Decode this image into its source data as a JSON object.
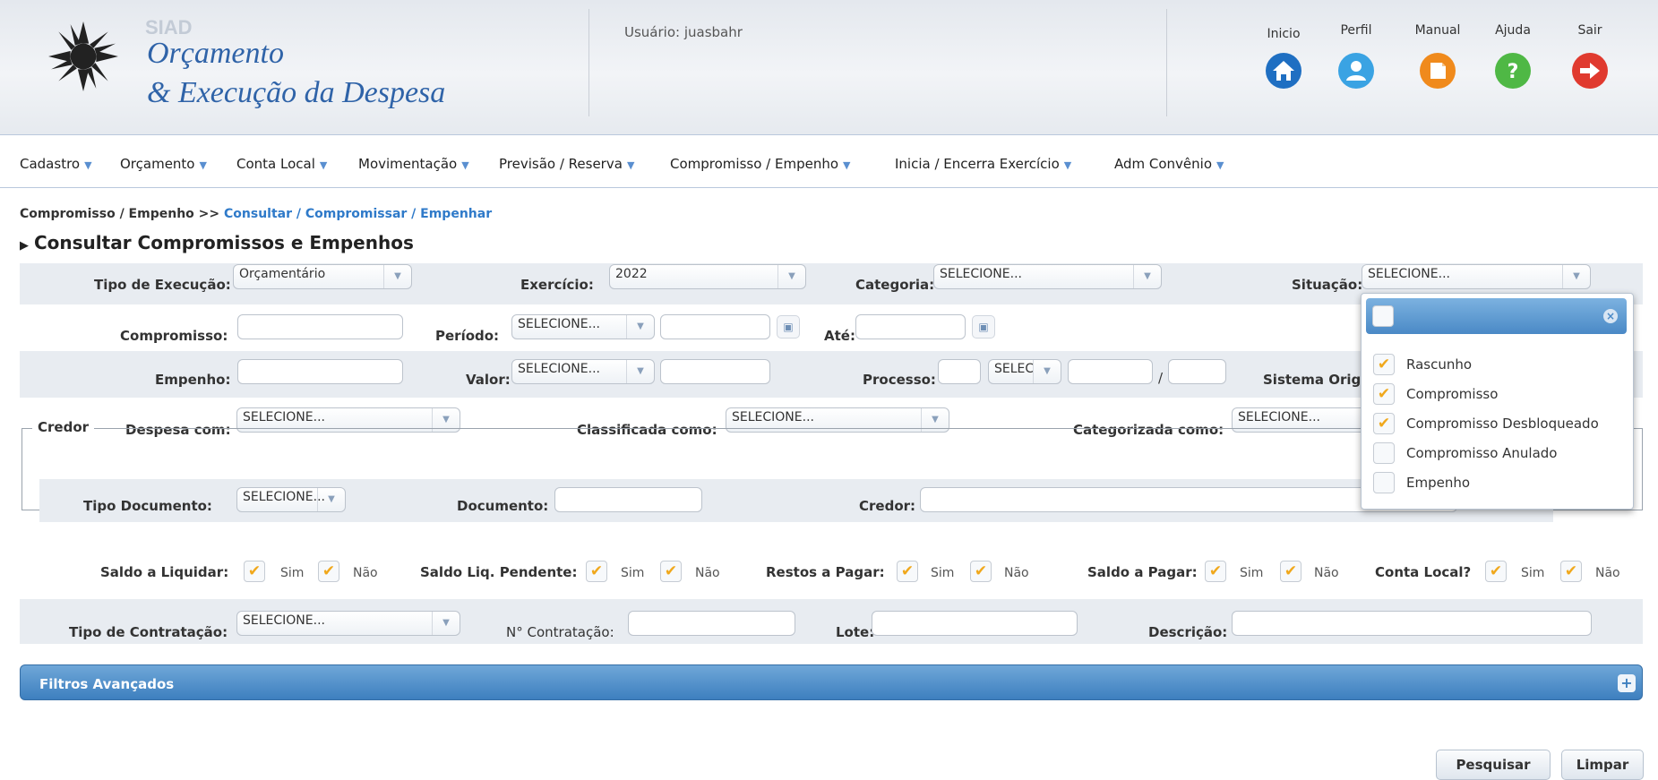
{
  "header": {
    "system_code": "SIAD",
    "title_line1": "Orçamento",
    "title_line2": "& Execução da Despesa",
    "user_label": "Usuário: juasbahr",
    "nav": [
      {
        "label": "Inicio",
        "icon": "home-icon",
        "color": "#1f6fc2"
      },
      {
        "label": "Perfil",
        "icon": "user-icon",
        "color": "#3aa3e3"
      },
      {
        "label": "Manual",
        "icon": "manual-icon",
        "color": "#f08a1c"
      },
      {
        "label": "Ajuda",
        "icon": "help-icon",
        "color": "#4fb845"
      },
      {
        "label": "Sair",
        "icon": "exit-icon",
        "color": "#e03a2f"
      }
    ]
  },
  "menu": [
    "Cadastro",
    "Orçamento",
    "Conta Local",
    "Movimentação",
    "Previsão / Reserva",
    "Compromisso / Empenho",
    "Inicia / Encerra Exercício",
    "Adm Convênio"
  ],
  "breadcrumb": {
    "root": "Compromisso / Empenho >>",
    "current": "Consultar / Compromissar / Empenhar"
  },
  "page_title": "Consultar Compromissos e Empenhos",
  "form": {
    "tipo_execucao": {
      "label": "Tipo de Execução:",
      "value": "Orçamentário"
    },
    "exercicio": {
      "label": "Exercício:",
      "value": "2022"
    },
    "categoria": {
      "label": "Categoria:",
      "value": "SELECIONE..."
    },
    "situacao": {
      "label": "Situação:",
      "value": "SELECIONE..."
    },
    "compromisso": {
      "label": "Compromisso:"
    },
    "periodo": {
      "label": "Período:",
      "value": "SELECIONE..."
    },
    "ate": {
      "label": "Até:"
    },
    "empenho": {
      "label": "Empenho:"
    },
    "valor": {
      "label": "Valor:",
      "value": "SELECIONE..."
    },
    "processo": {
      "label": "Processo:",
      "value": "SELEC",
      "sep": "/"
    },
    "sistema_origem": {
      "label": "Sistema Orig"
    },
    "despesa_com": {
      "label": "Despesa com:",
      "value": "SELECIONE..."
    },
    "classificada_como": {
      "label": "Classificada como:",
      "value": "SELECIONE..."
    },
    "categorizada_como": {
      "label": "Categorizada como:",
      "value": "SELECIONE..."
    },
    "credor_legend": "Credor",
    "tipo_documento": {
      "label": "Tipo Documento:",
      "value": "SELECIONE..."
    },
    "documento": {
      "label": "Documento:"
    },
    "credor": {
      "label": "Credor:"
    },
    "saldo_liquidar": {
      "label": "Saldo a Liquidar:",
      "yes": "Sim",
      "no": "Não"
    },
    "saldo_liq_pendente": {
      "label": "Saldo Liq. Pendente:",
      "yes": "Sim",
      "no": "Não"
    },
    "restos_pagar": {
      "label": "Restos a Pagar:",
      "yes": "Sim",
      "no": "Não"
    },
    "saldo_pagar": {
      "label": "Saldo a Pagar:",
      "yes": "Sim",
      "no": "Não"
    },
    "conta_local": {
      "label": "Conta Local?",
      "yes": "Sim",
      "no": "Não"
    },
    "tipo_contratacao": {
      "label": "Tipo de Contratação:",
      "value": "SELECIONE..."
    },
    "n_contratacao": {
      "label": "N° Contratação:"
    },
    "lote": {
      "label": "Lote:"
    },
    "descricao": {
      "label": "Descrição:"
    }
  },
  "advanced_filters": {
    "title": "Filtros Avançados"
  },
  "buttons": {
    "search": "Pesquisar",
    "clear": "Limpar"
  },
  "situacao_dropdown": {
    "items": [
      {
        "label": "Rascunho",
        "checked": true
      },
      {
        "label": "Compromisso",
        "checked": true
      },
      {
        "label": "Compromisso Desbloqueado",
        "checked": true
      },
      {
        "label": "Compromisso Anulado",
        "checked": false
      },
      {
        "label": "Empenho",
        "checked": false
      }
    ]
  },
  "colors": {
    "accent": "#2f7ac9",
    "check": "#f0a81c",
    "panel_header": "#4a89c6"
  }
}
